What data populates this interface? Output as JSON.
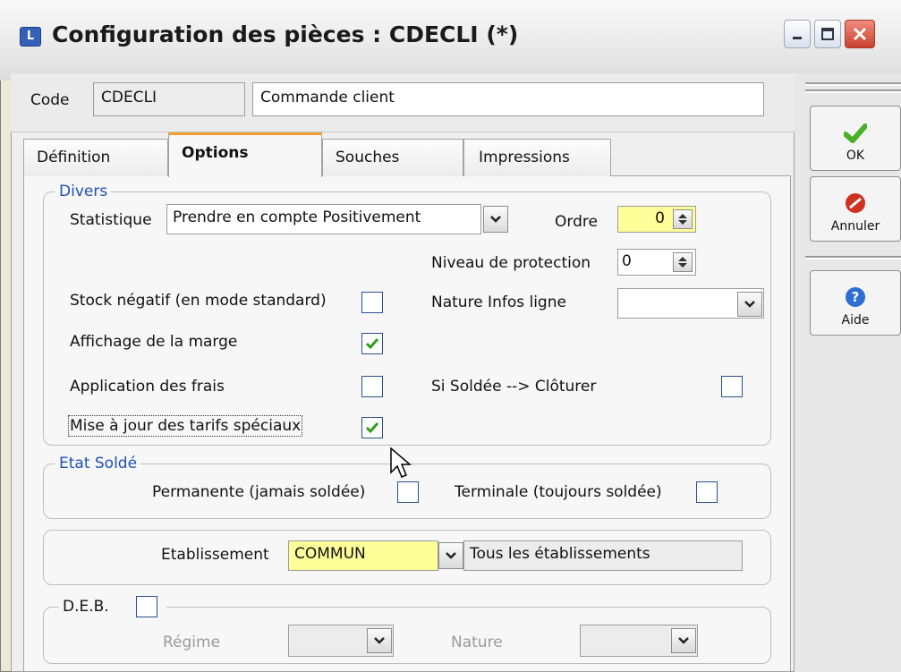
{
  "window": {
    "title": "Configuration des pièces : CDECLI (*)",
    "icon_letter": "L"
  },
  "header": {
    "code_label": "Code",
    "code_value": "CDECLI",
    "name_value": "Commande client"
  },
  "tabs": [
    {
      "label": "Définition"
    },
    {
      "label": "Options"
    },
    {
      "label": "Souches"
    },
    {
      "label": "Impressions"
    }
  ],
  "active_tab": "Options",
  "divers": {
    "legend": "Divers",
    "statistique_label": "Statistique",
    "statistique_value": "Prendre en compte Positivement",
    "ordre_label": "Ordre",
    "ordre_value": "0",
    "niveau_label": "Niveau de protection",
    "niveau_value": "0",
    "stock_label": "Stock négatif (en mode standard)",
    "stock_checked": false,
    "nature_infos_label": "Nature Infos ligne",
    "nature_infos_value": "",
    "marge_label": "Affichage de la marge",
    "marge_checked": true,
    "frais_label": "Application des frais",
    "frais_checked": false,
    "soldee_label": "Si Soldée --> Clôturer",
    "soldee_checked": false,
    "tarifs_label": "Mise à jour des tarifs spéciaux",
    "tarifs_checked": true
  },
  "etat_solde": {
    "legend": "Etat Soldé",
    "permanente_label": "Permanente (jamais soldée)",
    "permanente_checked": false,
    "terminale_label": "Terminale (toujours soldée)",
    "terminale_checked": false
  },
  "etablissement": {
    "label": "Etablissement",
    "value": "COMMUN",
    "description": "Tous les établissements"
  },
  "deb": {
    "label": "D.E.B.",
    "checked": false,
    "regime_label": "Régime",
    "regime_value": "",
    "nature_label": "Nature",
    "nature_value": ""
  },
  "buttons": {
    "ok": "OK",
    "annuler": "Annuler",
    "aide": "Aide"
  },
  "colors": {
    "ok_icon": "#4caf2a",
    "annuler_icon": "#d0311f",
    "aide_icon": "#2d6fd3",
    "legend": "#1f4fb5",
    "check": "#2f9e1b",
    "highlight_field": "#ffff99"
  }
}
